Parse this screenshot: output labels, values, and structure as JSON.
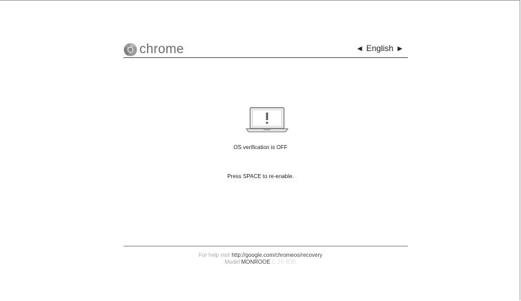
{
  "header": {
    "logo_text": "chrome",
    "language": "English",
    "lang_prev_glyph": "◀",
    "lang_next_glyph": "▶"
  },
  "main": {
    "icon": "laptop-warning-icon",
    "verification_status": "OS verification is OFF",
    "instruction": "Press SPACE to re-enable."
  },
  "footer": {
    "help_prefix": "For help visit",
    "help_url": "http://google.com/chromeos/recovery",
    "model_prefix": "Model",
    "model_name": "MONROOE",
    "model_suffix": "C 2A-E3E"
  },
  "colors": {
    "background": "#ffffff",
    "rule": "#555555",
    "muted_text": "#a8a8a8",
    "body_text": "#222222"
  }
}
